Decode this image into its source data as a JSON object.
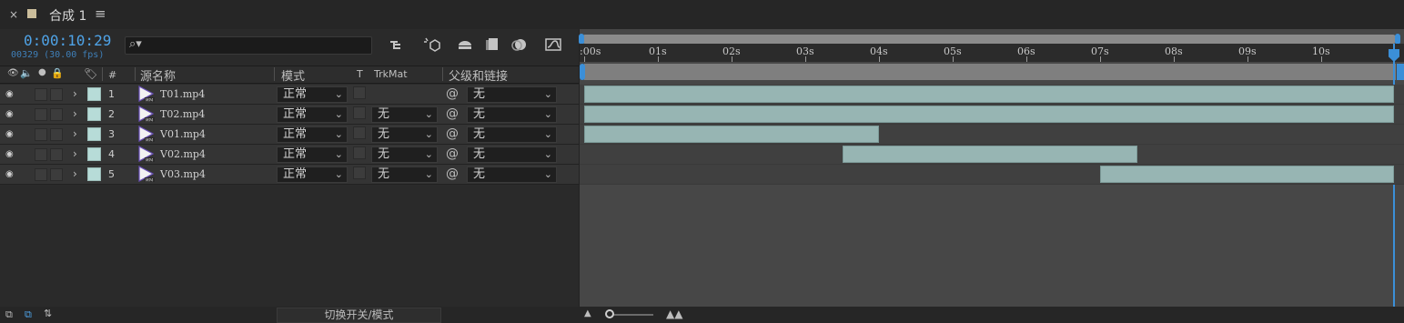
{
  "tab": {
    "close": "×",
    "title": "合成 1",
    "menu": "≡"
  },
  "time": {
    "timecode": "0:00:10:29",
    "frames": "00329 (30.00 fps)"
  },
  "search": {
    "placeholder": "",
    "icon": "search-icon"
  },
  "toolbar": {
    "icons": [
      "comp-flowchart-icon",
      "draft-3d-icon",
      "shy-layers-icon",
      "frame-blending-icon",
      "motion-blur-icon",
      "graph-editor-icon"
    ]
  },
  "columns": {
    "name": "源名称",
    "mode": "模式",
    "t": "T",
    "trkmat": "TrkMat",
    "parent": "父级和链接",
    "hash": "#"
  },
  "layers": [
    {
      "num": "1",
      "name": "T01.mp4",
      "mode": "正常",
      "trkmat": "",
      "parent": "无",
      "start": 0,
      "end": 11
    },
    {
      "num": "2",
      "name": "T02.mp4",
      "mode": "正常",
      "trkmat": "无",
      "parent": "无",
      "start": 0,
      "end": 11
    },
    {
      "num": "3",
      "name": "V01.mp4",
      "mode": "正常",
      "trkmat": "无",
      "parent": "无",
      "start": 0,
      "end": 4
    },
    {
      "num": "4",
      "name": "V02.mp4",
      "mode": "正常",
      "trkmat": "无",
      "parent": "无",
      "start": 3.5,
      "end": 7.5
    },
    {
      "num": "5",
      "name": "V03.mp4",
      "mode": "正常",
      "trkmat": "无",
      "parent": "无",
      "start": 7,
      "end": 11
    }
  ],
  "ruler": {
    "labels": [
      ":00s",
      "01s",
      "02s",
      "03s",
      "04s",
      "05s",
      "06s",
      "07s",
      "08s",
      "09s",
      "10s"
    ]
  },
  "bottom": {
    "toggle_label": "切换开关/模式"
  },
  "colors": {
    "accent": "#3b8fd8",
    "label": "#b7dcd8",
    "bar": "#97b5b3"
  }
}
